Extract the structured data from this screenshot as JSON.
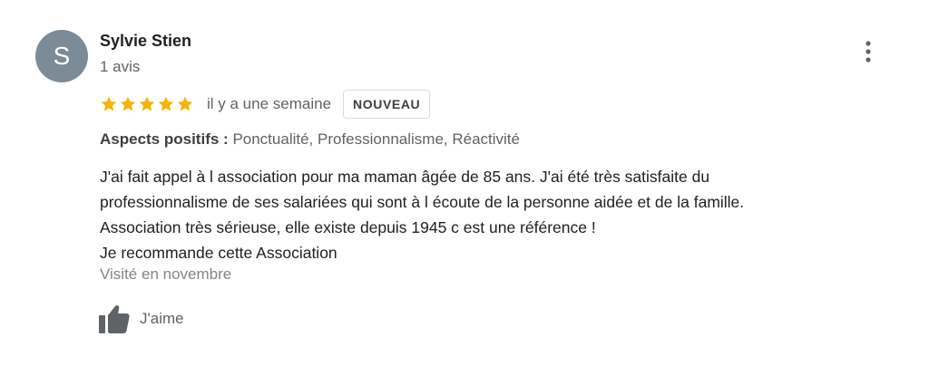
{
  "review": {
    "author": {
      "initial": "S",
      "name": "Sylvie Stien",
      "review_count": "1 avis",
      "avatar_color": "#7b8b98"
    },
    "rating": {
      "stars": 5,
      "max": 5,
      "star_color": "#f4b400"
    },
    "date": "il y a une semaine",
    "badge": "NOUVEAU",
    "aspects": {
      "label": "Aspects positifs :",
      "values": "Ponctualité, Professionnalisme, Réactivité"
    },
    "text_lines": [
      "J'ai fait appel à l association pour ma maman âgée de 85 ans. J'ai été très satisfaite du",
      "professionnalisme de ses salariées qui sont à l écoute de la personne aidée et de la famille.",
      "Association très sérieuse, elle existe depuis 1945 c est une référence !",
      "Je recommande cette Association"
    ],
    "visit": "Visité en novembre",
    "like_label": "J'aime",
    "icons": {
      "more": "more-vert-icon",
      "star": "star-icon",
      "like": "thumb-up-icon"
    }
  }
}
